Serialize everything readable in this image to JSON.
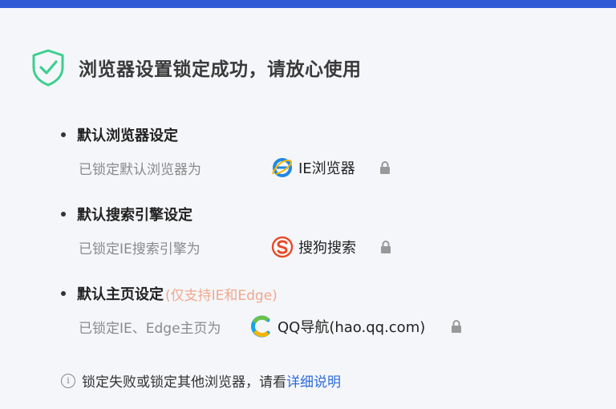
{
  "header": {
    "title": "浏览器设置锁定成功，请放心使用",
    "icon": "shield-check-icon",
    "accent_color": "#2f5bd6",
    "shield_color": "#3ccf8e"
  },
  "sections": [
    {
      "title": "默认浏览器设定",
      "note": "",
      "desc": "已锁定默认浏览器为",
      "value": "IE浏览器",
      "app_icon": "ie-icon",
      "locked": true
    },
    {
      "title": "默认搜索引擎设定",
      "note": "",
      "desc": "已锁定IE搜索引擎为",
      "value": "搜狗搜索",
      "app_icon": "sogou-icon",
      "locked": true
    },
    {
      "title": "默认主页设定",
      "note": "(仅支持IE和Edge)",
      "desc": "已锁定IE、Edge主页为",
      "value": "QQ导航(hao.qq.com)",
      "app_icon": "qq-nav-icon",
      "locked": true
    }
  ],
  "footer": {
    "text": "锁定失败或锁定其他浏览器，请看",
    "link": "详细说明",
    "icon": "info-icon"
  }
}
